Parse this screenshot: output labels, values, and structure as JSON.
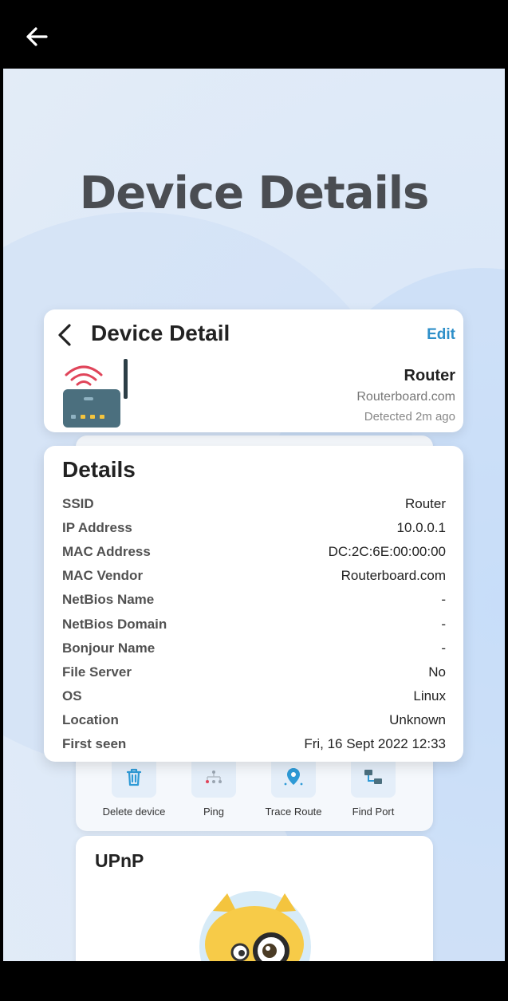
{
  "screen": {
    "hero_title": "Device Details"
  },
  "header": {
    "title": "Device Detail",
    "edit_label": "Edit",
    "device_name": "Router",
    "vendor": "Routerboard.com",
    "detected": "Detected 2m ago"
  },
  "details": {
    "title": "Details",
    "rows": [
      {
        "key": "SSID",
        "value": "Router"
      },
      {
        "key": "IP Address",
        "value": "10.0.0.1"
      },
      {
        "key": "MAC Address",
        "value": "DC:2C:6E:00:00:00"
      },
      {
        "key": "MAC Vendor",
        "value": "Routerboard.com"
      },
      {
        "key": "NetBios Name",
        "value": "-"
      },
      {
        "key": "NetBios Domain",
        "value": "-"
      },
      {
        "key": "Bonjour Name",
        "value": "-"
      },
      {
        "key": "File Server",
        "value": "No"
      },
      {
        "key": "OS",
        "value": "Linux"
      },
      {
        "key": "Location",
        "value": "Unknown"
      },
      {
        "key": "First seen",
        "value": "Fri, 16 Sept 2022 12:33"
      }
    ]
  },
  "actions": [
    {
      "label": "Delete device",
      "icon": "trash-icon"
    },
    {
      "label": "Ping",
      "icon": "ping-icon"
    },
    {
      "label": "Trace Route",
      "icon": "location-pin-icon"
    },
    {
      "label": "Find Port",
      "icon": "network-port-icon"
    }
  ],
  "upnp": {
    "title": "UPnP"
  },
  "colors": {
    "accent": "#2d8fc9",
    "router_body": "#4b6f7e",
    "wifi_red": "#e0455a"
  }
}
